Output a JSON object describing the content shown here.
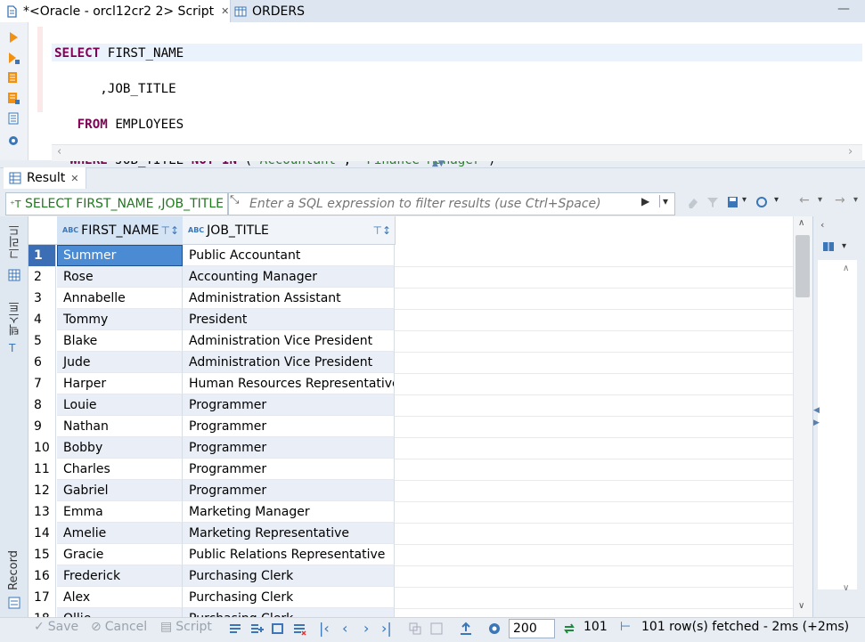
{
  "tabs": {
    "script_label": "*<Oracle - orcl12cr2 2> Script",
    "orders_label": "ORDERS"
  },
  "editor": {
    "lines": [
      "SELECT FIRST_NAME",
      "      ,JOB_TITLE",
      "   FROM EMPLOYEES",
      "  WHERE JOB_TITLE NOT IN ('Accountant', 'Finance Manager')",
      ";"
    ]
  },
  "result": {
    "tab_label": "Result",
    "query_label": "SELECT FIRST_NAME ,JOB_TITLE",
    "filter_placeholder": "Enter a SQL expression to filter results (use Ctrl+Space)",
    "columns": [
      "FIRST_NAME",
      "JOB_TITLE"
    ],
    "column_type_badge": "ABC",
    "rows": [
      {
        "n": "1",
        "first": "Summer",
        "job": "Public Accountant"
      },
      {
        "n": "2",
        "first": "Rose",
        "job": "Accounting Manager"
      },
      {
        "n": "3",
        "first": "Annabelle",
        "job": "Administration Assistant"
      },
      {
        "n": "4",
        "first": "Tommy",
        "job": "President"
      },
      {
        "n": "5",
        "first": "Blake",
        "job": "Administration Vice President"
      },
      {
        "n": "6",
        "first": "Jude",
        "job": "Administration Vice President"
      },
      {
        "n": "7",
        "first": "Harper",
        "job": "Human Resources Representative"
      },
      {
        "n": "8",
        "first": "Louie",
        "job": "Programmer"
      },
      {
        "n": "9",
        "first": "Nathan",
        "job": "Programmer"
      },
      {
        "n": "10",
        "first": "Bobby",
        "job": "Programmer"
      },
      {
        "n": "11",
        "first": "Charles",
        "job": "Programmer"
      },
      {
        "n": "12",
        "first": "Gabriel",
        "job": "Programmer"
      },
      {
        "n": "13",
        "first": "Emma",
        "job": "Marketing Manager"
      },
      {
        "n": "14",
        "first": "Amelie",
        "job": "Marketing Representative"
      },
      {
        "n": "15",
        "first": "Gracie",
        "job": "Public Relations Representative"
      },
      {
        "n": "16",
        "first": "Frederick",
        "job": "Purchasing Clerk"
      },
      {
        "n": "17",
        "first": "Alex",
        "job": "Purchasing Clerk"
      },
      {
        "n": "18",
        "first": "Ollie",
        "job": "Purchasing Clerk"
      }
    ],
    "side_labels": {
      "grid": "그리드",
      "text": "텍스트",
      "record": "Record"
    }
  },
  "bottom": {
    "save": "Save",
    "cancel": "Cancel",
    "script": "Script",
    "fetch_size": "200",
    "count": "101",
    "status": "101 row(s) fetched - 2ms (+2ms)"
  },
  "colors": {
    "keyword": "#7f0055",
    "string": "#2a7f2a",
    "selection": "#4a8bd4",
    "row_alt": "#e9eef7"
  }
}
